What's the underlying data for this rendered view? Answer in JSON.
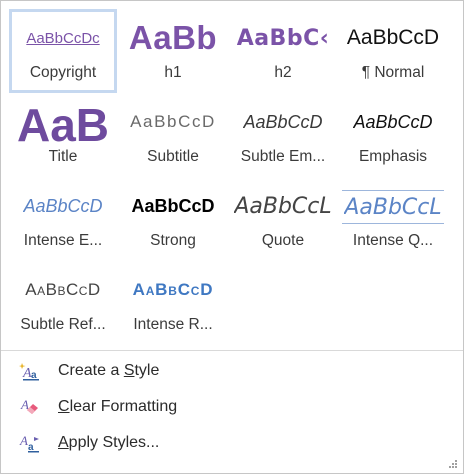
{
  "styles": [
    {
      "preview": "AaBbCcDc",
      "label": "Copyright",
      "selected": true
    },
    {
      "preview": "AaBb",
      "label": "h1"
    },
    {
      "preview": "AaBbC‹",
      "label": "h2"
    },
    {
      "preview": "AaBbCcD",
      "label": "¶ Normal"
    },
    {
      "preview": "AaB",
      "label": "Title"
    },
    {
      "preview": "AaBbCcD",
      "label": "Subtitle"
    },
    {
      "preview": "AaBbCcD",
      "label": "Subtle Em..."
    },
    {
      "preview": "AaBbCcD",
      "label": "Emphasis"
    },
    {
      "preview": "AaBbCcD",
      "label": "Intense E..."
    },
    {
      "preview": "AaBbCcD",
      "label": "Strong"
    },
    {
      "preview": "AaBbCcL",
      "label": "Quote"
    },
    {
      "preview": "AaBbCcL",
      "label": "Intense Q..."
    },
    {
      "preview": "AaBbCcD",
      "label": "Subtle Ref..."
    },
    {
      "preview": "AaBbCcD",
      "label": "Intense R..."
    }
  ],
  "menu": {
    "create_style": {
      "pre": "Create a ",
      "key": "S",
      "post": "tyle",
      "icon": "create-style-icon"
    },
    "clear_formatting": {
      "pre": "",
      "key": "C",
      "post": "lear Formatting",
      "icon": "eraser-icon"
    },
    "apply_styles": {
      "pre": "",
      "key": "A",
      "post": "pply Styles...",
      "icon": "apply-styles-icon"
    }
  },
  "colors": {
    "heading_purple": "#7b53a8",
    "accent_blue": "#5b84c6",
    "selection_border": "#c5d8f0"
  }
}
